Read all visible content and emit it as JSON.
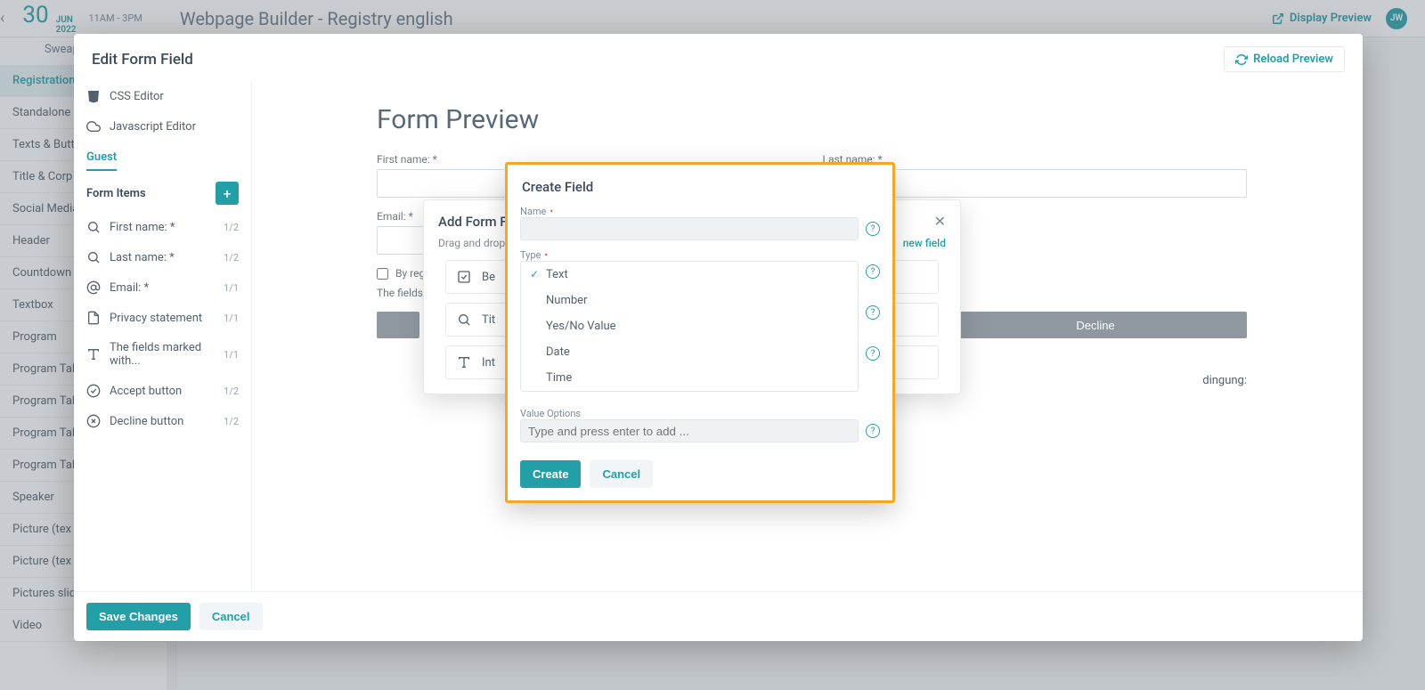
{
  "header": {
    "date_day": "30",
    "date_month": "JUN",
    "date_year": "2022",
    "date_time": "11AM - 3PM",
    "subtitle": "Sweap",
    "page_title": "Webpage Builder - Registry english",
    "display_preview": "Display Preview",
    "avatar_initials": "JW"
  },
  "left_nav": [
    "Registration",
    "Standalone (optional)",
    "Texts & Buttons Registration",
    "Title & Corp",
    "Social Media",
    "Header",
    "Countdown",
    "Textbox",
    "Program",
    "Program Tal",
    "Program Tal",
    "Program Tal",
    "Program Tal",
    "Speaker",
    "Picture (tex",
    "Picture (tex",
    "Pictures slid",
    "Video"
  ],
  "modal": {
    "title": "Edit Form Field",
    "reload": "Reload Preview",
    "save": "Save Changes",
    "cancel": "Cancel",
    "side": {
      "css": "CSS Editor",
      "js": "Javascript Editor",
      "tab": "Guest",
      "form_items": "Form Items"
    },
    "items": [
      {
        "label": "First name: *",
        "count": "1/2",
        "icon": "search"
      },
      {
        "label": "Last name: *",
        "count": "1/2",
        "icon": "search"
      },
      {
        "label": "Email: *",
        "count": "1/1",
        "icon": "at"
      },
      {
        "label": "Privacy statement",
        "count": "1/1",
        "icon": "doc"
      },
      {
        "label": "The fields marked with...",
        "count": "1/1",
        "icon": "text"
      },
      {
        "label": "Accept button",
        "count": "1/2",
        "icon": "check"
      },
      {
        "label": "Decline button",
        "count": "1/2",
        "icon": "xcircle"
      }
    ],
    "preview": {
      "heading": "Form Preview",
      "first_name": "First name: *",
      "last_name": "Last name: *",
      "email": "Email: *",
      "checkbox": "By regis",
      "dragdrop": "Drag and drop",
      "marked": "The fields n",
      "decline": "Decline",
      "cond_text": "dingung:"
    }
  },
  "add_panel": {
    "title": "Add Form F",
    "new_field": "new field",
    "items": [
      {
        "label": "Be",
        "icon": "checkbox"
      },
      {
        "label": "Tit",
        "icon": "search"
      },
      {
        "label": "Int",
        "icon": "text"
      }
    ]
  },
  "create": {
    "title": "Create Field",
    "name_label": "Name",
    "type_label": "Type",
    "value_options_label": "Value Options",
    "value_placeholder": "Type and press enter to add ...",
    "types": [
      "Text",
      "Number",
      "Yes/No Value",
      "Date",
      "Time"
    ],
    "create_btn": "Create",
    "cancel_btn": "Cancel"
  }
}
